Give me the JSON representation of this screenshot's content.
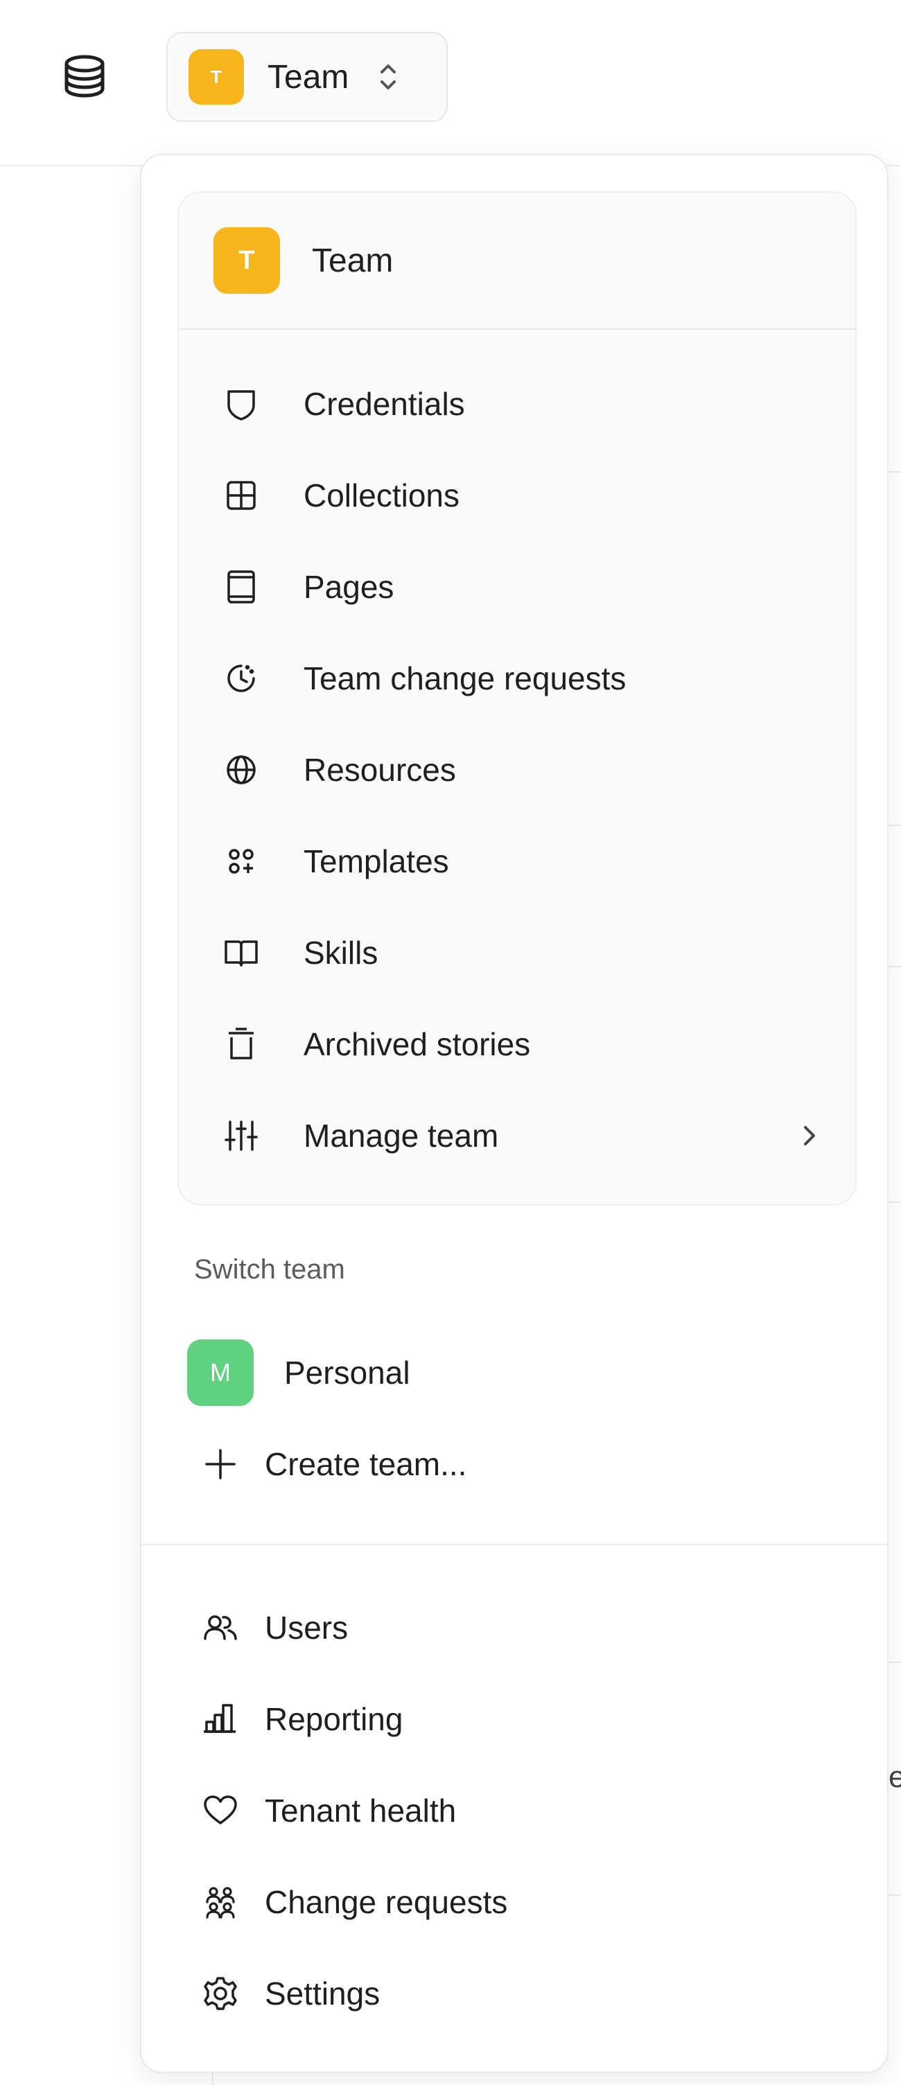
{
  "header": {
    "logo_icon": "database-icon",
    "team_switcher": {
      "avatar_letter": "T",
      "label": "Team",
      "icon": "chevron-up-down-icon"
    }
  },
  "dropdown": {
    "current_team": {
      "avatar_letter": "T",
      "name": "Team",
      "avatar_color": "#f7b51c"
    },
    "team_menu": [
      {
        "label": "Credentials",
        "icon": "shield-icon"
      },
      {
        "label": "Collections",
        "icon": "grid-icon"
      },
      {
        "label": "Pages",
        "icon": "page-icon"
      },
      {
        "label": "Team change requests",
        "icon": "clock-icon"
      },
      {
        "label": "Resources",
        "icon": "globe-icon"
      },
      {
        "label": "Templates",
        "icon": "templates-icon"
      },
      {
        "label": "Skills",
        "icon": "book-icon"
      },
      {
        "label": "Archived stories",
        "icon": "trash-icon"
      },
      {
        "label": "Manage team",
        "icon": "sliders-icon",
        "has_submenu": true
      }
    ],
    "switch_team": {
      "label": "Switch team",
      "teams": [
        {
          "label": "Personal",
          "avatar_letter": "M",
          "avatar_color": "#5fd17f"
        }
      ],
      "create_label": "Create team..."
    },
    "global_menu": [
      {
        "label": "Users",
        "icon": "users-icon"
      },
      {
        "label": "Reporting",
        "icon": "bar-chart-icon"
      },
      {
        "label": "Tenant health",
        "icon": "heart-icon"
      },
      {
        "label": "Change requests",
        "icon": "change-requests-icon"
      },
      {
        "label": "Settings",
        "icon": "gear-icon"
      }
    ]
  },
  "background": {
    "partial_text": "e"
  }
}
